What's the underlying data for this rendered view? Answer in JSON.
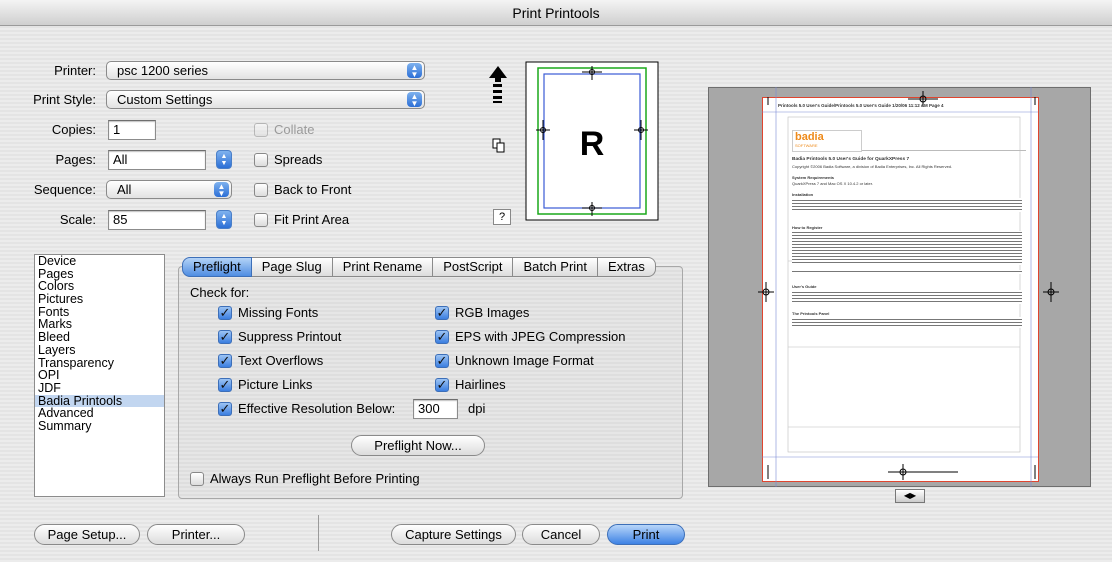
{
  "window": {
    "title": "Print Printools"
  },
  "printer": {
    "label": "Printer:",
    "value": "psc 1200 series"
  },
  "print_style": {
    "label": "Print Style:",
    "value": "Custom Settings"
  },
  "copies": {
    "label": "Copies:",
    "value": "1"
  },
  "collate": {
    "label": "Collate",
    "checked": false,
    "enabled": false
  },
  "pages": {
    "label": "Pages:",
    "value": "All"
  },
  "spreads": {
    "label": "Spreads",
    "checked": false
  },
  "sequence": {
    "label": "Sequence:",
    "value": "All"
  },
  "back_to_front": {
    "label": "Back to Front",
    "checked": false
  },
  "scale": {
    "label": "Scale:",
    "value": "85"
  },
  "fit_print_area": {
    "label": "Fit Print Area",
    "checked": false
  },
  "preview": {
    "letter": "R",
    "help": "?"
  },
  "sidebar": {
    "items": [
      {
        "label": "Device"
      },
      {
        "label": "Pages"
      },
      {
        "label": "Colors"
      },
      {
        "label": "Pictures"
      },
      {
        "label": "Fonts"
      },
      {
        "label": "Marks"
      },
      {
        "label": "Bleed"
      },
      {
        "label": "Layers"
      },
      {
        "label": "Transparency"
      },
      {
        "label": "OPI"
      },
      {
        "label": "JDF"
      },
      {
        "label": "Badia Printools"
      },
      {
        "label": "Advanced"
      },
      {
        "label": "Summary"
      }
    ],
    "selected": "Badia Printools"
  },
  "tabs": [
    "Preflight",
    "Page Slug",
    "Print Rename",
    "PostScript",
    "Batch Print",
    "Extras"
  ],
  "active_tab": "Preflight",
  "preflight": {
    "check_for": "Check for:",
    "left_checks": [
      "Missing Fonts",
      "Suppress Printout",
      "Text Overflows",
      "Picture Links"
    ],
    "right_checks": [
      "RGB Images",
      "EPS with JPEG Compression",
      "Unknown Image Format",
      "Hairlines"
    ],
    "eff_res_label": "Effective Resolution Below:",
    "eff_res_value": "300",
    "eff_res_unit": "dpi",
    "preflight_now": "Preflight Now...",
    "always_run": "Always Run Preflight Before Printing"
  },
  "buttons": {
    "page_setup": "Page Setup...",
    "printer": "Printer...",
    "capture": "Capture Settings",
    "cancel": "Cancel",
    "print": "Print"
  },
  "thumbnail": {
    "slug": "Printools 5.0 User's Guide/Printools 5.0 User's Guide  1/20/06  11:12 AM  Page 4",
    "logo": "badia",
    "logo_sub": "SOFTWARE",
    "heading1": "Badia Printools 5.0 User's Guide for QuarkXPress 7",
    "copyright": "Copyright ©2006 Badia Software, a division of Badia Enterprises, Inc. All Rights Reserved.",
    "h_req": "System Requirements",
    "req": "QuarkXPress 7 and Mac OS X 10.4.2 or later.",
    "h_inst": "Installation",
    "h_reg": "How to Register",
    "h_guide": "User's Guide",
    "h_panel": "The Printools Panel"
  },
  "colors": {
    "accent": "#3d82e4",
    "crop": "#e0452f"
  }
}
